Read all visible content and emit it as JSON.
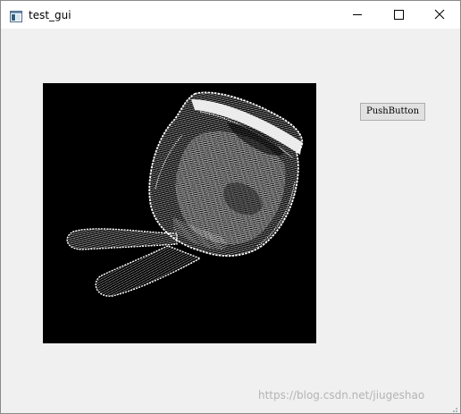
{
  "window": {
    "title": "test_gui",
    "icon": "app-window-icon",
    "controls": {
      "minimize_icon": "minimize-icon",
      "maximize_icon": "maximize-icon",
      "close_icon": "close-icon"
    }
  },
  "main": {
    "canvas": {
      "background": "#000000",
      "content": "white point-cloud 3D render of a bunny model",
      "point_color": "#ffffff"
    },
    "push_button": {
      "label": "PushButton"
    }
  },
  "watermark": {
    "text": "https://blog.csdn.net/jiugeshao"
  },
  "colors": {
    "client_background": "#f0f0f0",
    "titlebar_background": "#ffffff",
    "button_face": "#e1e1e1",
    "button_border": "#adadad"
  }
}
